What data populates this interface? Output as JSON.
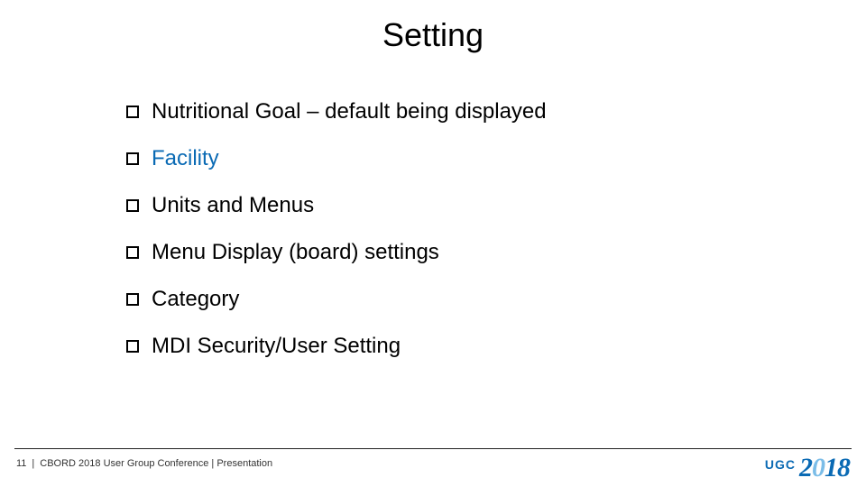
{
  "title": "Setting",
  "bullets": [
    {
      "text": "Nutritional Goal – default being displayed",
      "link": false
    },
    {
      "text": "Facility",
      "link": true
    },
    {
      "text": "Units and Menus",
      "link": false
    },
    {
      "text": "Menu Display (board) settings",
      "link": false
    },
    {
      "text": "Category",
      "link": false
    },
    {
      "text": "MDI Security/User Setting",
      "link": false
    }
  ],
  "footer": {
    "page": "11",
    "sep1": "|",
    "text": "CBORD 2018 User Group Conference | Presentation"
  },
  "logo": {
    "ugc": "UGC",
    "y1": "2",
    "y2": "0",
    "y3": "1",
    "y4": "8"
  }
}
